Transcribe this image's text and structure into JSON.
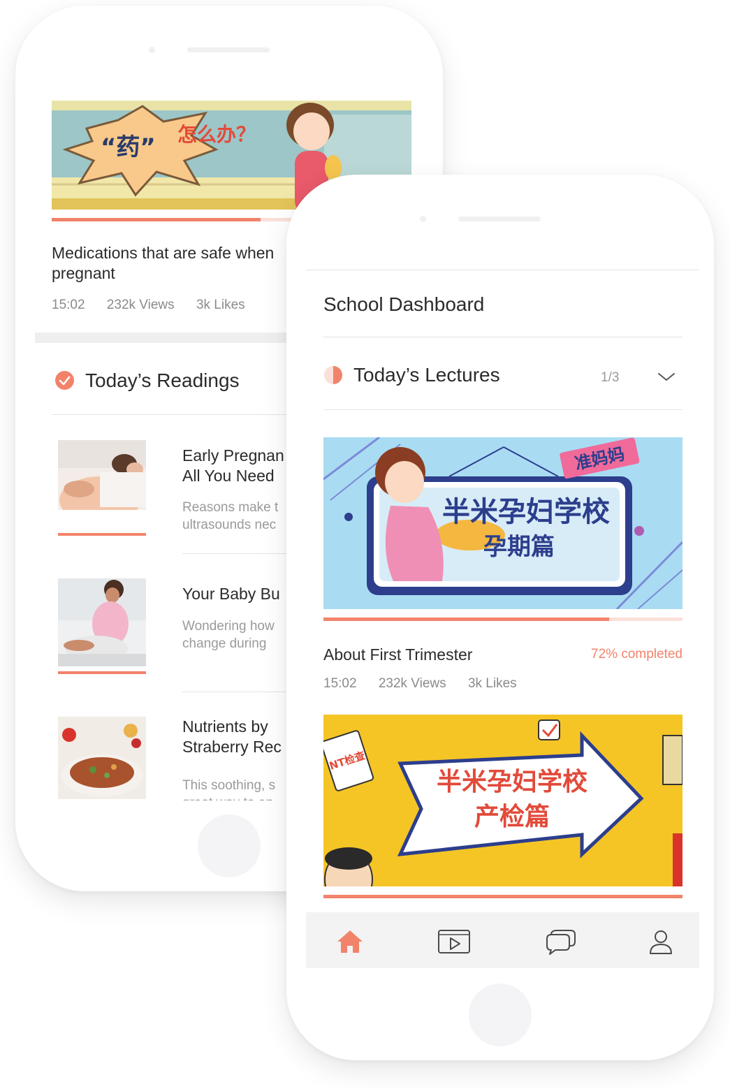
{
  "colors": {
    "accent": "#F2836B",
    "accent_light": "#FBE0D9",
    "text": "#2B2B2B",
    "muted": "#8A8A8A",
    "tabbar_bg": "#F3F3F3"
  },
  "back_screen": {
    "hero_caption": "“药”怎么办？",
    "lecture": {
      "title": "Medications that are safe when pregnant",
      "duration": "15:02",
      "views": "232k Views",
      "likes": "3k Likes",
      "progress": 0.58
    },
    "readings_section": {
      "icon": "check-circle-icon",
      "title": "Today’s Readings"
    },
    "readings": [
      {
        "title": "Early Pregnan\nAll You Need",
        "desc": "Reasons make t\nultrasounds nec",
        "thumb": "pregnant-belly-photo"
      },
      {
        "title": "Your Baby Bu",
        "desc": "Wondering how\nchange during",
        "thumb": "pregnant-woman-photo"
      },
      {
        "title": "Nutrients by\nStraberry Rec",
        "desc": "This soothing, s\ngreat way to en",
        "thumb": "soup-bowl-photo"
      }
    ]
  },
  "front_screen": {
    "header_title": "School Dashboard",
    "lectures_section": {
      "icon": "half-circle-progress-icon",
      "title": "Today’s Lectures",
      "counter": "1/3",
      "toggle_icon": "chevron-down-icon"
    },
    "lecture_cards": [
      {
        "banner_badge": "准妈妈",
        "banner_title": "半米孕妇学校",
        "banner_subtitle": "孕期篇",
        "title": "About First Trimester",
        "status": "72% completed",
        "progress": 0.795,
        "duration": "15:02",
        "views": "232k Views",
        "likes": "3k Likes"
      },
      {
        "banner_title": "半米孕妇学校",
        "banner_subtitle": "产检篇",
        "banner_tag": "NT检查",
        "progress": 1.0
      }
    ],
    "tabbar": [
      {
        "icon": "home-icon",
        "active": true
      },
      {
        "icon": "video-play-icon",
        "active": false
      },
      {
        "icon": "chat-bubbles-icon",
        "active": false
      },
      {
        "icon": "user-icon",
        "active": false
      }
    ]
  }
}
